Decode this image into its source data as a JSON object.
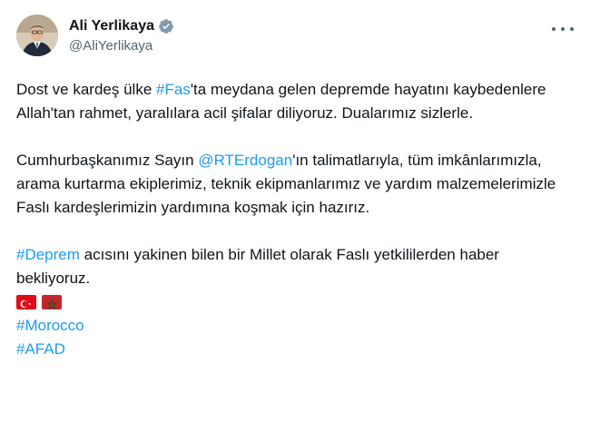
{
  "author": {
    "display_name": "Ali Yerlikaya",
    "handle": "@AliYerlikaya"
  },
  "tweet": {
    "p1": [
      {
        "t": "Dost ve kardeş ülke "
      },
      {
        "t": "#Fas",
        "link": true
      },
      {
        "t": "'ta meydana gelen depremde hayatını kaybedenlere Allah'tan rahmet, yaralılara acil şifalar diliyoruz. Dualarımız sizlerle."
      }
    ],
    "p2": [
      {
        "t": "Cumhurbaşkanımız Sayın "
      },
      {
        "t": "@RTErdogan",
        "link": true
      },
      {
        "t": "'ın talimatlarıyla, tüm imkânlarımızla, arama kurtarma ekiplerimiz, teknik ekipmanlarımız ve yardım malzemelerimizle Faslı kardeşlerimizin yardımına koşmak için hazırız."
      }
    ],
    "p3": [
      {
        "t": "#Deprem",
        "link": true
      },
      {
        "t": " acısını yakinen bilen bir Millet olarak Faslı yetkililerden haber bekliyoruz."
      }
    ],
    "flags": [
      "turkey-flag-icon",
      "morocco-flag-icon"
    ],
    "hashtags": [
      "#Morocco",
      "#AFAD"
    ]
  },
  "colors": {
    "link": "#1d9bf0",
    "text": "#0f1419",
    "secondary": "#536471"
  }
}
